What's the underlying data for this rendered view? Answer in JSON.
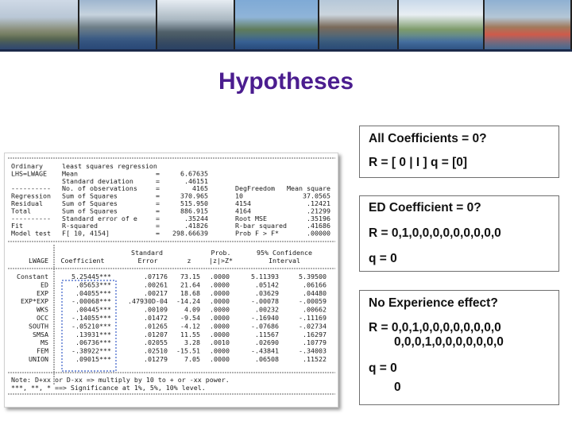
{
  "slide": {
    "title": "Hypotheses",
    "title_color": "#4b1d8f"
  },
  "banner": {
    "photos": [
      "lake-town-photo",
      "lakeside-town-photo",
      "tree-lake-photo",
      "mountain-lake-photo",
      "town-shore-photo",
      "promenade-photo",
      "flowers-lake-photo"
    ]
  },
  "hypotheses": [
    {
      "lines": [
        "All Coefficients = 0?",
        "R = [ 0 | I ]  q = [0]"
      ]
    },
    {
      "lines": [
        "ED Coefficient = 0?",
        "R = 0,1,0,0,0,0,0,0,0,0,0",
        "q =  0"
      ]
    },
    {
      "lines": [
        "No Experience effect?",
        "R = 0,0,1,0,0,0,0,0,0,0,0",
        "0,0,0,1,0,0,0,0,0,0,0",
        "q = 0",
        "0"
      ]
    }
  ],
  "regression": {
    "header_rows": [
      [
        "Ordinary",
        "least squares regression"
      ],
      [
        "LHS=LWAGE",
        "Mean",
        "=",
        "6.67635"
      ],
      [
        "",
        "Standard deviation",
        "=",
        ".46151"
      ],
      [
        "----------",
        "No. of observations",
        "=",
        "4165",
        "DegFreedom",
        "Mean square"
      ],
      [
        "Regression",
        "Sum of Squares",
        "=",
        "370.965",
        "10",
        "37.0565"
      ],
      [
        "Residual",
        "Sum of Squares",
        "=",
        "515.950",
        "4154",
        ".12421"
      ],
      [
        "Total",
        "Sum of Squares",
        "=",
        "886.915",
        "4164",
        ".21299"
      ],
      [
        "----------",
        "Standard error of e",
        "=",
        ".35244",
        "Root MSE",
        ".35196"
      ],
      [
        "Fit",
        "R-squared",
        "=",
        ".41826",
        "R-bar squared",
        ".41686"
      ],
      [
        "Model test",
        "F[ 10, 4154]",
        "=",
        "298.66639",
        "Prob F > F*",
        ".00000"
      ]
    ],
    "col_headers_top": [
      "Standard",
      "Prob.",
      "95% Confidence"
    ],
    "col_headers": [
      "LWAGE",
      "Coefficient",
      "Error",
      "z",
      "|z|>Z*",
      "Interval"
    ],
    "rows": [
      [
        "Constant",
        "5.25445***",
        ".07176",
        "73.15",
        ".0000",
        "5.11393",
        "5.39500"
      ],
      [
        "ED",
        ".05653***",
        ".00261",
        "21.64",
        ".0000",
        ".05142",
        ".06166"
      ],
      [
        "EXP",
        ".04055***",
        ".00217",
        "18.68",
        ".0000",
        ".03629",
        ".04480"
      ],
      [
        "EXP*EXP",
        "-.00068***",
        ".47930D-04",
        "-14.24",
        ".0000",
        "-.00078",
        "-.00059"
      ],
      [
        "WKS",
        ".00445***",
        ".00109",
        "4.09",
        ".0000",
        ".00232",
        ".00662"
      ],
      [
        "OCC",
        "-.14055***",
        ".01472",
        "-9.54",
        ".0000",
        "-.16940",
        "-.11169"
      ],
      [
        "SOUTH",
        "-.05210***",
        ".01265",
        "-4.12",
        ".0000",
        "-.07686",
        "-.02734"
      ],
      [
        "SMSA",
        ".13931***",
        ".01207",
        "11.55",
        ".0000",
        ".11567",
        ".16297"
      ],
      [
        "MS",
        ".06736***",
        ".02055",
        "3.28",
        ".0010",
        ".02690",
        ".10779"
      ],
      [
        "FEM",
        "-.38922***",
        ".02510",
        "-15.51",
        ".0000",
        "-.43841",
        "-.34003"
      ],
      [
        "UNION",
        ".09015***",
        ".01279",
        "7.05",
        ".0000",
        ".06508",
        ".11522"
      ]
    ],
    "footnotes": [
      "Note: D+xx or D-xx => multiply by 10 to + or -xx power.",
      "***, **, * ==> Significance at 1%, 5%, 10% level."
    ]
  }
}
